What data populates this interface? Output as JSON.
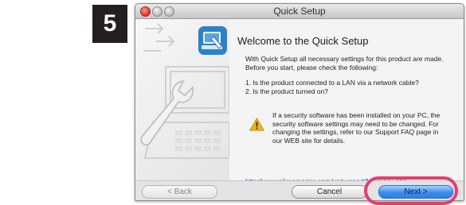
{
  "step_badge": "5",
  "window": {
    "title": "Quick Setup"
  },
  "content": {
    "heading": "Welcome to the Quick Setup",
    "intro_line1": "With Quick Setup all necessary settings for this product are made.",
    "intro_line2": "Before you start, please check the following:",
    "questions": [
      "1. Is the product connected to a LAN via a network cable?",
      "2. Is the product turned on?"
    ],
    "warning_line1": "If a security software has been installed on your PC, the",
    "warning_line2": "security software settings may need to be changed. For",
    "warning_line3": "changing the settings, refer to our Support FAQ page in",
    "warning_line4": "our WEB site for details.",
    "link": "http://www.silexamerica.com/us/support/faq/index.php"
  },
  "buttons": {
    "back": "< Back",
    "cancel": "Cancel",
    "next": "Next >"
  },
  "colors": {
    "highlight": "#e23f6f",
    "next_button": "#3c8ded",
    "link": "#1f3fbd"
  },
  "icons": {
    "app": "network-setup-icon",
    "warning": "warning-icon"
  }
}
